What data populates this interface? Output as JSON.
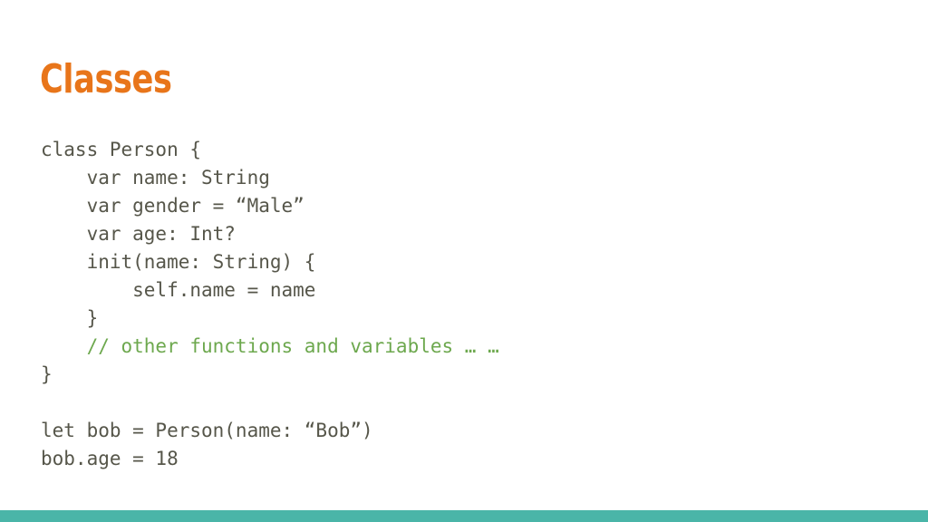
{
  "slide": {
    "title": "Classes",
    "background_color": "#FFFFFF",
    "title_color": "#E8751A",
    "code_color": "#56564A",
    "comment_color": "#6DA84E",
    "footer_color": "#4AB5A8"
  },
  "code": {
    "language": "swift",
    "lines": [
      {
        "text": "class Person {",
        "kind": "code"
      },
      {
        "text": "    var name: String",
        "kind": "code"
      },
      {
        "text": "    var gender = “Male”",
        "kind": "code"
      },
      {
        "text": "    var age: Int?",
        "kind": "code"
      },
      {
        "text": "    init(name: String) {",
        "kind": "code"
      },
      {
        "text": "        self.name = name",
        "kind": "code"
      },
      {
        "text": "    }",
        "kind": "code"
      },
      {
        "text": "    // other functions and variables … …",
        "kind": "comment"
      },
      {
        "text": "}",
        "kind": "code"
      },
      {
        "text": "",
        "kind": "blank"
      },
      {
        "text": "let bob = Person(name: “Bob”)",
        "kind": "code"
      },
      {
        "text": "bob.age = 18",
        "kind": "code"
      }
    ]
  }
}
